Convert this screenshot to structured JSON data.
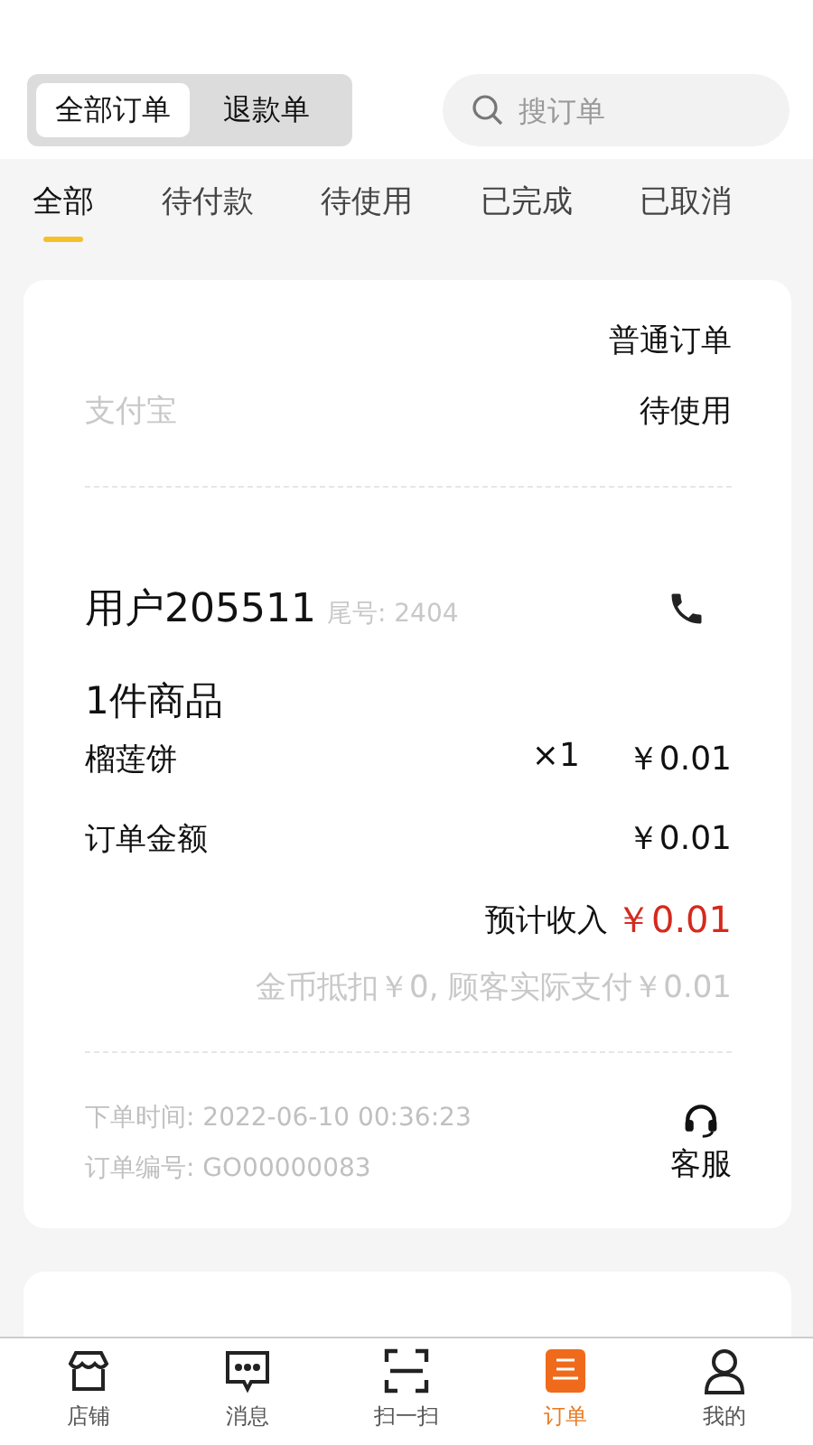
{
  "segment": [
    {
      "label": "全部订单",
      "selected": true
    },
    {
      "label": "退款单",
      "selected": false
    }
  ],
  "search": {
    "placeholder": "搜订单"
  },
  "tabs": [
    {
      "label": "全部",
      "selected": true
    },
    {
      "label": "待付款",
      "selected": false
    },
    {
      "label": "待使用",
      "selected": false
    },
    {
      "label": "已完成",
      "selected": false
    },
    {
      "label": "已取消",
      "selected": false
    }
  ],
  "orders": [
    {
      "kind": "full",
      "order_type": "普通订单",
      "payment": "支付宝",
      "status": "待使用",
      "customer": "用户205511",
      "tail": "尾号: 2404",
      "item_count": "1件商品",
      "items": [
        {
          "name": "榴莲饼",
          "qty": "×1",
          "price": "￥0.01"
        }
      ],
      "amount_label": "订单金额",
      "amount": "￥0.01",
      "income_label": "预计收入",
      "income": "￥0.01",
      "note": "金币抵扣￥0, 顾客实际支付￥0.01",
      "time": "下单时间: 2022-06-10 00:36:23",
      "number": "订单编号: GO00000083",
      "service": "客服"
    },
    {
      "kind": "partial"
    }
  ],
  "nav": [
    {
      "label": "店铺",
      "kind": "store",
      "selected": false
    },
    {
      "label": "消息",
      "kind": "message",
      "selected": false
    },
    {
      "label": "扫一扫",
      "kind": "scan",
      "selected": false
    },
    {
      "label": "订单",
      "kind": "order",
      "selected": true
    },
    {
      "label": "我的",
      "kind": "user",
      "selected": false
    }
  ]
}
